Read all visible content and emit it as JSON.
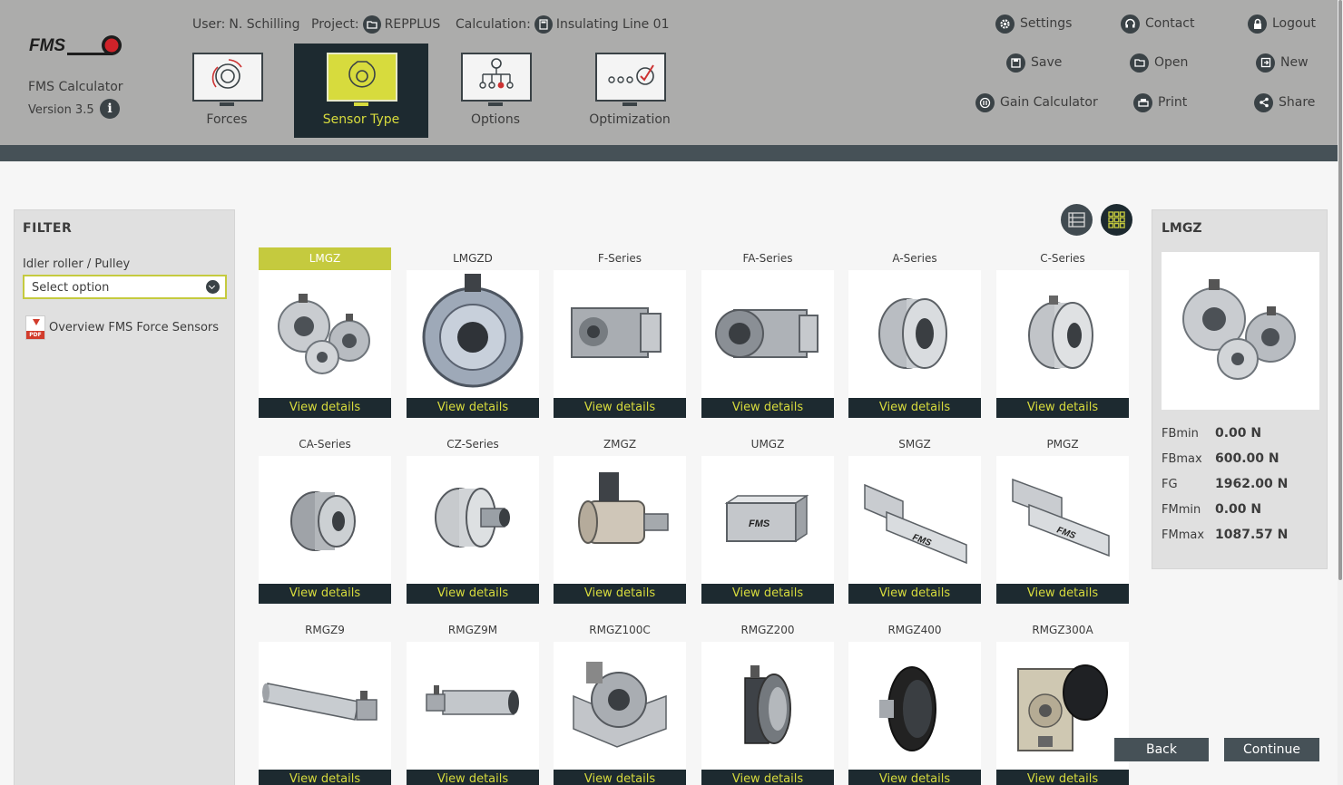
{
  "app": {
    "name": "FMS Calculator",
    "version": "Version 3.5",
    "logo_text": "FMS"
  },
  "context": {
    "user_label": "User:",
    "user_name": "N. Schilling",
    "project_label": "Project:",
    "project_name": "REPPLUS",
    "calculation_label": "Calculation:",
    "calculation_name": "Insulating Line 01"
  },
  "steps": [
    {
      "label": "Forces",
      "icon": "forces-icon",
      "active": false
    },
    {
      "label": "Sensor Type",
      "icon": "sensor-type-icon",
      "active": true
    },
    {
      "label": "Options",
      "icon": "options-icon",
      "active": false
    },
    {
      "label": "Optimization",
      "icon": "optimization-icon",
      "active": false
    }
  ],
  "actions": {
    "settings": "Settings",
    "contact": "Contact",
    "logout": "Logout",
    "save": "Save",
    "open": "Open",
    "new": "New",
    "gain_calculator": "Gain Calculator",
    "print": "Print",
    "share": "Share"
  },
  "filter": {
    "title": "FILTER",
    "label": "Idler roller / Pulley",
    "select_value": "Select option",
    "pdf_link": "Overview FMS Force Sensors",
    "pdf_badge": "PDF"
  },
  "view_modes": [
    "list-view-icon",
    "grid-view-icon"
  ],
  "accent_color": "#c5ca3e",
  "dark_color": "#1d2a30",
  "sensors": [
    {
      "name": "LMGZ",
      "button": "View details",
      "selected": true
    },
    {
      "name": "LMGZD",
      "button": "View details",
      "selected": false
    },
    {
      "name": "F-Series",
      "button": "View details",
      "selected": false
    },
    {
      "name": "FA-Series",
      "button": "View details",
      "selected": false
    },
    {
      "name": "A-Series",
      "button": "View details",
      "selected": false
    },
    {
      "name": "C-Series",
      "button": "View details",
      "selected": false
    },
    {
      "name": "CA-Series",
      "button": "View details",
      "selected": false
    },
    {
      "name": "CZ-Series",
      "button": "View details",
      "selected": false
    },
    {
      "name": "ZMGZ",
      "button": "View details",
      "selected": false
    },
    {
      "name": "UMGZ",
      "button": "View details",
      "selected": false
    },
    {
      "name": "SMGZ",
      "button": "View details",
      "selected": false
    },
    {
      "name": "PMGZ",
      "button": "View details",
      "selected": false
    },
    {
      "name": "RMGZ9",
      "button": "View details",
      "selected": false
    },
    {
      "name": "RMGZ9M",
      "button": "View details",
      "selected": false
    },
    {
      "name": "RMGZ100C",
      "button": "View details",
      "selected": false
    },
    {
      "name": "RMGZ200",
      "button": "View details",
      "selected": false
    },
    {
      "name": "RMGZ400",
      "button": "View details",
      "selected": false
    },
    {
      "name": "RMGZ300A",
      "button": "View details",
      "selected": false
    }
  ],
  "detail": {
    "title": "LMGZ",
    "props": [
      {
        "label": "FBmin",
        "value": "0.00 N"
      },
      {
        "label": "FBmax",
        "value": "600.00 N"
      },
      {
        "label": "FG",
        "value": "1962.00 N"
      },
      {
        "label": "FMmin",
        "value": "0.00 N"
      },
      {
        "label": "FMmax",
        "value": "1087.57 N"
      }
    ]
  },
  "footer": {
    "back": "Back",
    "continue": "Continue"
  }
}
